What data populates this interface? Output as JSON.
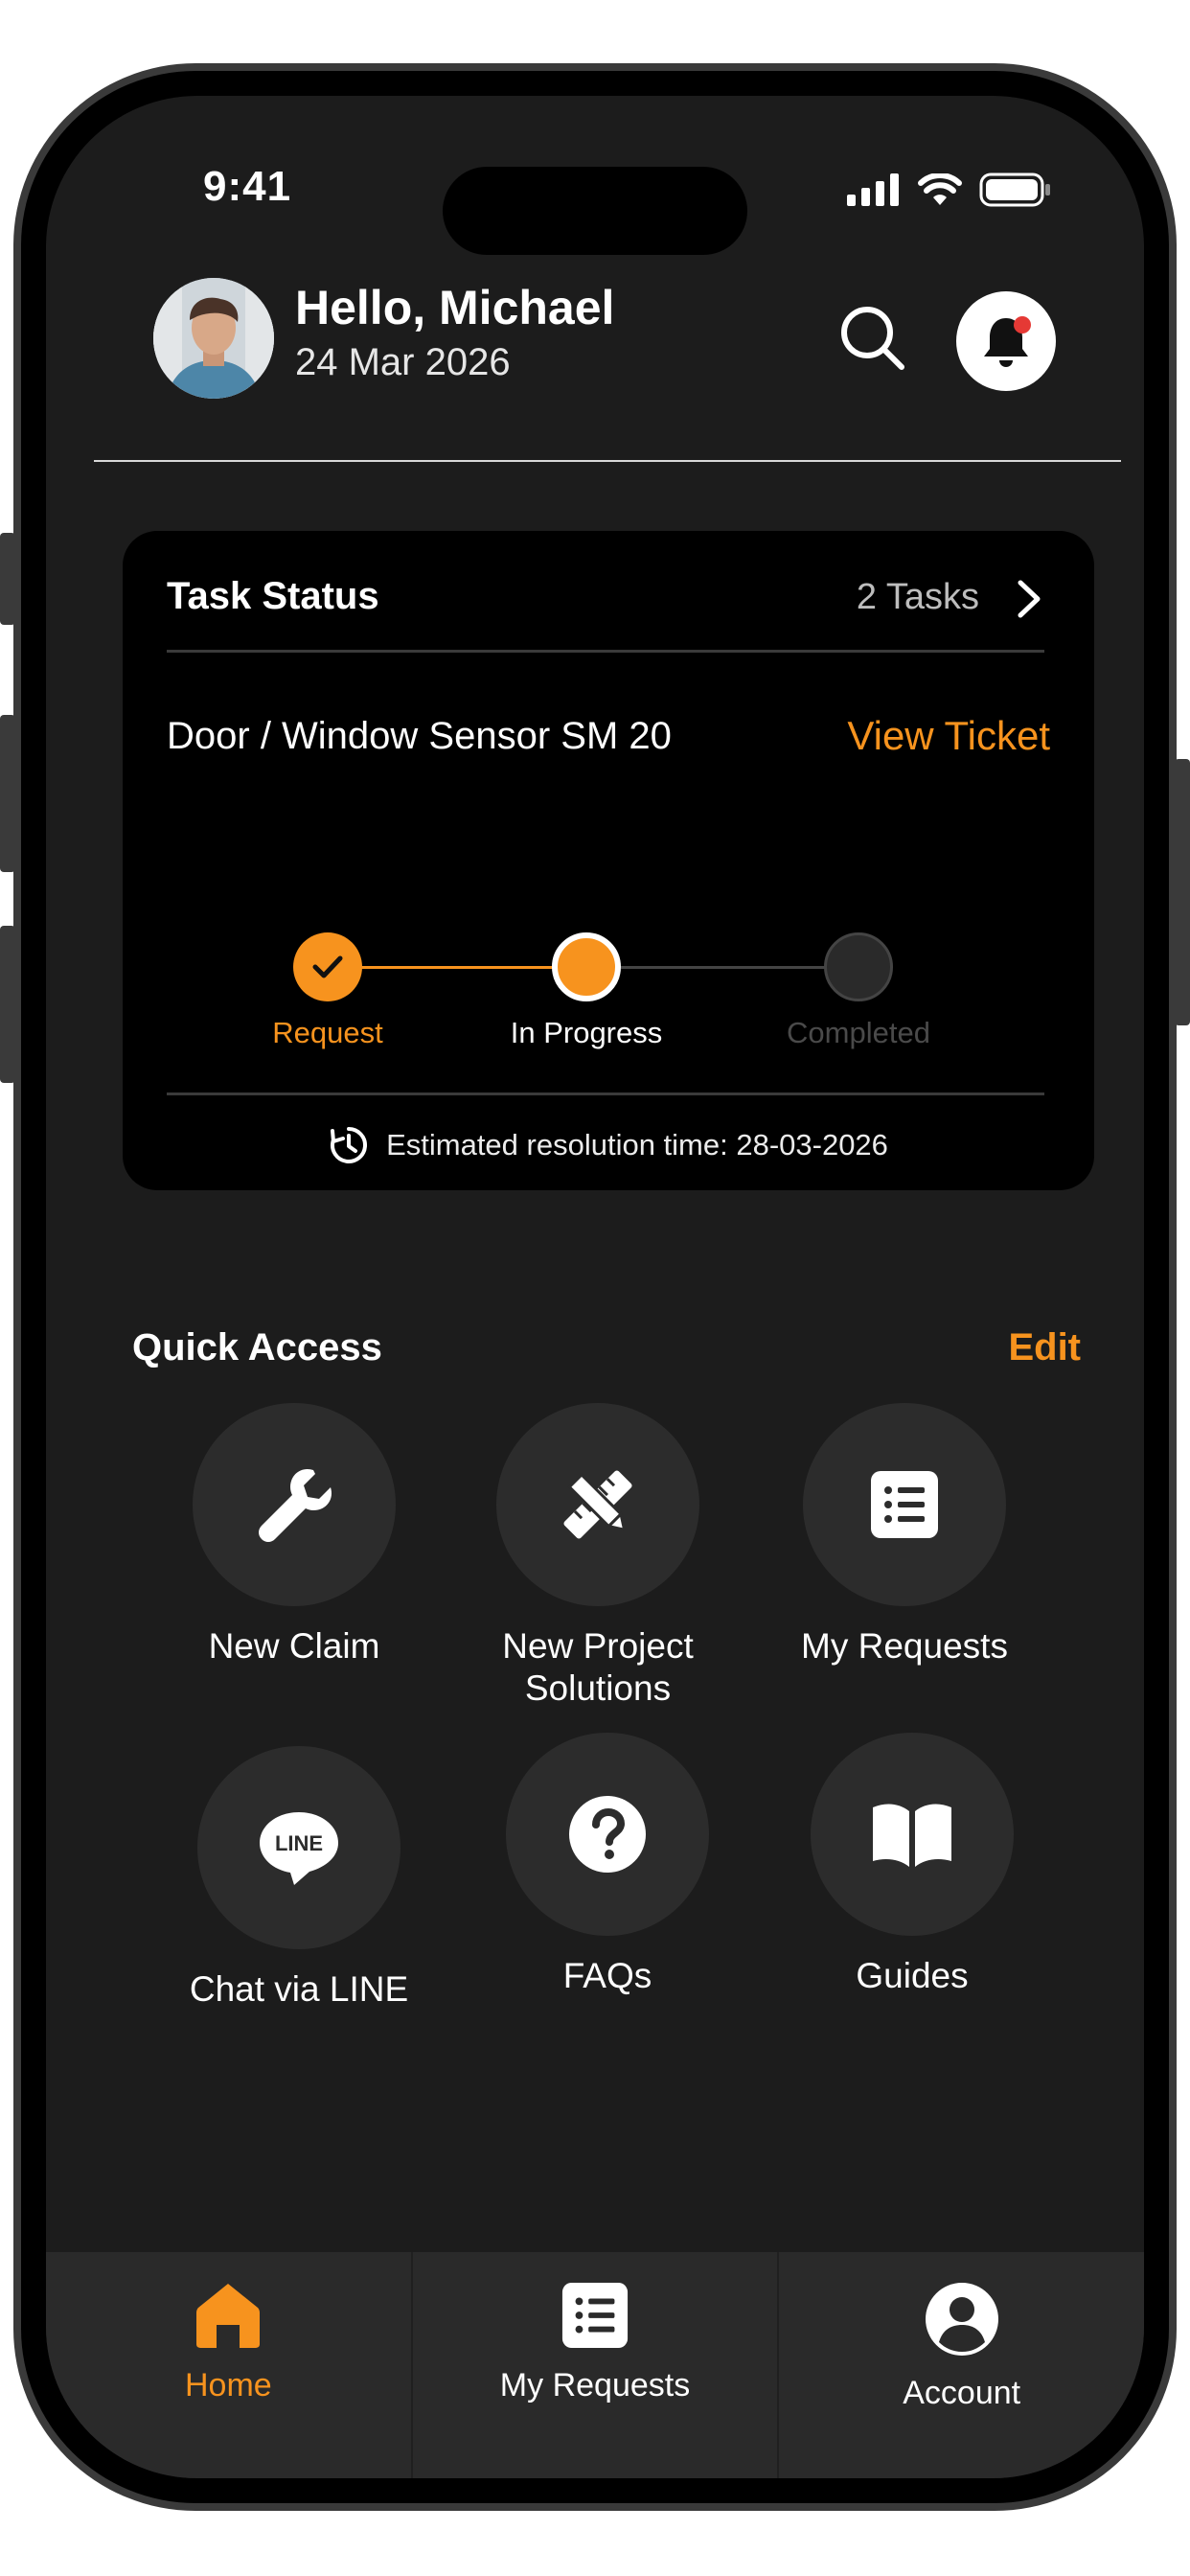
{
  "status_bar": {
    "time": "9:41"
  },
  "header": {
    "greeting": "Hello, Michael",
    "date": "24 Mar 2026",
    "icons": {
      "search": "search-icon",
      "notifications": "bell-icon"
    }
  },
  "task_status": {
    "title": "Task Status",
    "count": "2 Tasks",
    "ticket_name": "Door / Window Sensor SM 20",
    "view_ticket": "View Ticket",
    "steps": [
      {
        "label": "Request",
        "state": "done"
      },
      {
        "label": "In Progress",
        "state": "current"
      },
      {
        "label": "Completed",
        "state": "pending"
      }
    ],
    "eta": "Estimated resolution time: 28-03-2026"
  },
  "quick_access": {
    "title": "Quick Access",
    "edit": "Edit",
    "items": [
      {
        "label": "New Claim",
        "icon": "wrench-icon"
      },
      {
        "label": "New Project\nSolutions",
        "icon": "pencil-ruler-icon"
      },
      {
        "label": "My Requests",
        "icon": "list-icon"
      },
      {
        "label": "Chat via LINE",
        "icon": "line-chat-icon"
      },
      {
        "label": "FAQs",
        "icon": "question-icon"
      },
      {
        "label": "Guides",
        "icon": "book-icon"
      }
    ]
  },
  "bottom_nav": {
    "items": [
      {
        "label": "Home",
        "icon": "home-icon",
        "active": true
      },
      {
        "label": "My Requests",
        "icon": "list-icon",
        "active": false
      },
      {
        "label": "Account",
        "icon": "account-icon",
        "active": false
      }
    ]
  },
  "colors": {
    "accent": "#f7931e",
    "background": "#1c1c1c",
    "card": "#000000",
    "circle": "#2c2c2c",
    "inactive_step": "#2a2a2a",
    "notification_dot": "#e53935"
  }
}
